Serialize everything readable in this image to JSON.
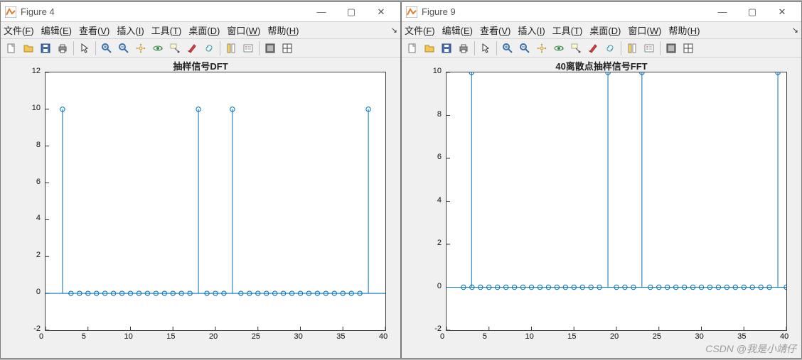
{
  "watermark": "CSDN @我是小靖仔",
  "windows": [
    {
      "title": "Figure 4",
      "menus": [
        "文件(F)",
        "编辑(E)",
        "查看(V)",
        "插入(I)",
        "工具(T)",
        "桌面(D)",
        "窗口(W)",
        "帮助(H)"
      ],
      "plot_title": "抽样信号DFT",
      "xlim": [
        0,
        40
      ],
      "ylim": [
        -2,
        12
      ],
      "xticks": [
        0,
        5,
        10,
        15,
        20,
        25,
        30,
        35,
        40
      ],
      "yticks": [
        -2,
        0,
        2,
        4,
        6,
        8,
        10,
        12
      ]
    },
    {
      "title": "Figure 9",
      "menus": [
        "文件(F)",
        "编辑(E)",
        "查看(V)",
        "插入(I)",
        "工具(T)",
        "桌面(D)",
        "窗口(W)",
        "帮助(H)"
      ],
      "plot_title": "40离散点抽样信号FFT",
      "xlim": [
        0,
        40
      ],
      "ylim": [
        -2,
        10
      ],
      "xticks": [
        0,
        5,
        10,
        15,
        20,
        25,
        30,
        35,
        40
      ],
      "yticks": [
        -2,
        0,
        2,
        4,
        6,
        8,
        10
      ]
    }
  ],
  "toolbar_icons": [
    "new-file-icon",
    "open-file-icon",
    "save-icon",
    "print-icon",
    "pointer-icon",
    "zoom-in-icon",
    "zoom-out-icon",
    "pan-icon",
    "rotate3d-icon",
    "data-cursor-icon",
    "brush-icon",
    "link-plot-icon",
    "colorbar-icon",
    "legend-icon",
    "dock-icon",
    "layout-icon"
  ],
  "win_buttons": [
    "minimize-button",
    "maximize-button",
    "close-button"
  ],
  "chart_data": [
    {
      "type": "bar",
      "title": "抽样信号DFT",
      "xlabel": "",
      "ylabel": "",
      "xlim": [
        0,
        40
      ],
      "ylim": [
        -2,
        12
      ],
      "x": [
        2,
        3,
        4,
        5,
        6,
        7,
        8,
        9,
        10,
        11,
        12,
        13,
        14,
        15,
        16,
        17,
        18,
        19,
        20,
        21,
        22,
        23,
        24,
        25,
        26,
        27,
        28,
        29,
        30,
        31,
        32,
        33,
        34,
        35,
        36,
        37,
        38
      ],
      "values": [
        10,
        0,
        0,
        0,
        0,
        0,
        0,
        0,
        0,
        0,
        0,
        0,
        0,
        0,
        0,
        0,
        10,
        0,
        0,
        0,
        10,
        0,
        0,
        0,
        0,
        0,
        0,
        0,
        0,
        0,
        0,
        0,
        0,
        0,
        0,
        0,
        10
      ],
      "style": "stem",
      "marker": "o",
      "color": "#0072bd"
    },
    {
      "type": "bar",
      "title": "40离散点抽样信号FFT",
      "xlabel": "",
      "ylabel": "",
      "xlim": [
        0,
        40
      ],
      "ylim": [
        -2,
        10
      ],
      "x": [
        2,
        2.95,
        3,
        4,
        5,
        6,
        7,
        8,
        9,
        10,
        11,
        12,
        13,
        14,
        15,
        16,
        17,
        18,
        19,
        20,
        21,
        22,
        23,
        24,
        25,
        26,
        27,
        28,
        29,
        30,
        31,
        32,
        33,
        34,
        35,
        36,
        37,
        38,
        39,
        40
      ],
      "values": [
        0,
        10,
        0,
        0,
        0,
        0,
        0,
        0,
        0,
        0,
        0,
        0,
        0,
        0,
        0,
        0,
        0,
        0,
        10,
        0,
        0,
        0,
        10,
        0,
        0,
        0,
        0,
        0,
        0,
        0,
        0,
        0,
        0,
        0,
        0,
        0,
        0,
        0,
        10,
        0
      ],
      "style": "stem",
      "marker": "o",
      "color": "#0072bd"
    }
  ]
}
